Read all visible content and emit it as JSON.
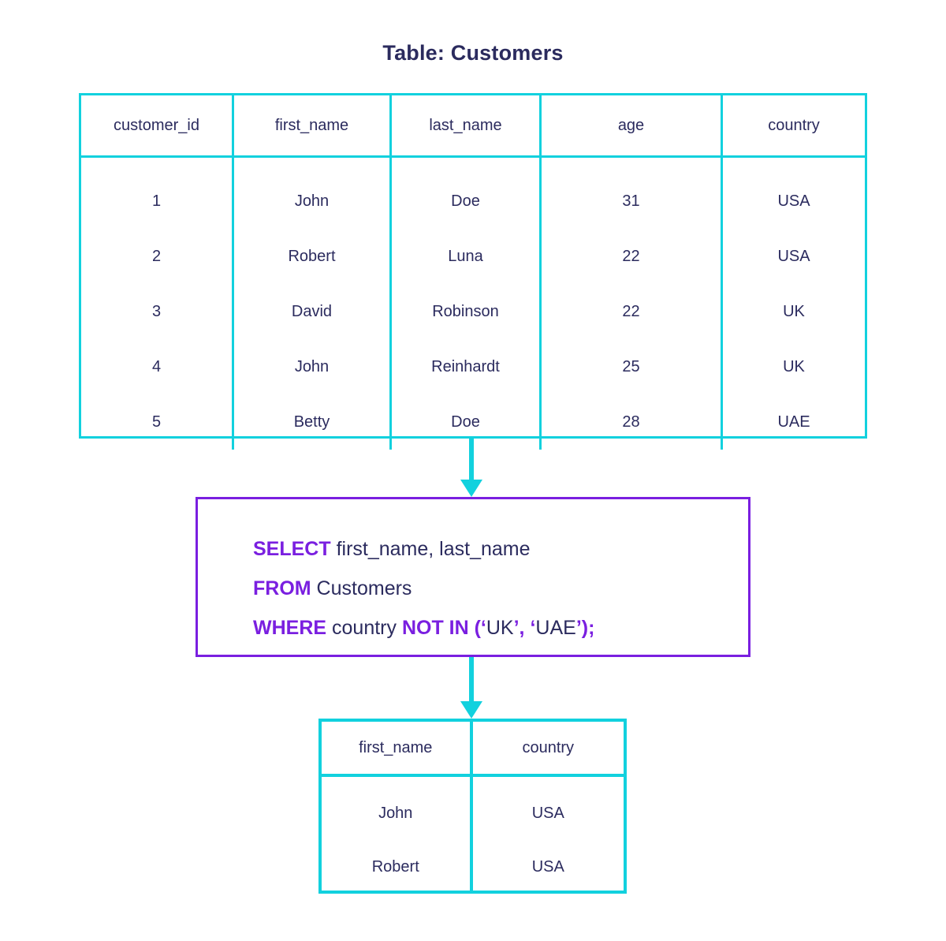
{
  "diagram": {
    "title": "Table: Customers",
    "colors": {
      "table_border": "#12d1de",
      "query_border": "#7a1fe0",
      "keyword": "#7a1fe0",
      "text": "#2b2b5e",
      "arrow": "#12d1de"
    }
  },
  "source_table": {
    "name": "Customers",
    "columns": [
      "customer_id",
      "first_name",
      "last_name",
      "age",
      "country"
    ],
    "rows": [
      [
        "1",
        "John",
        "Doe",
        "31",
        "USA"
      ],
      [
        "2",
        "Robert",
        "Luna",
        "22",
        "USA"
      ],
      [
        "3",
        "David",
        "Robinson",
        "22",
        "UK"
      ],
      [
        "4",
        "John",
        "Reinhardt",
        "25",
        "UK"
      ],
      [
        "5",
        "Betty",
        "Doe",
        "28",
        "UAE"
      ]
    ],
    "column_values": {
      "customer_id": [
        "1",
        "2",
        "3",
        "4",
        "5"
      ],
      "first_name": [
        "John",
        "Robert",
        "David",
        "John",
        "Betty"
      ],
      "last_name": [
        "Doe",
        "Luna",
        "Robinson",
        "Reinhardt",
        "Doe"
      ],
      "age": [
        "31",
        "22",
        "22",
        "25",
        "28"
      ],
      "country": [
        "USA",
        "USA",
        "UK",
        "UK",
        "UAE"
      ]
    }
  },
  "query": {
    "full_text": "SELECT first_name, last_name FROM Customers WHERE country NOT IN ('UK', 'UAE');",
    "line1": {
      "keyword": "SELECT",
      "rest": " first_name, last_name"
    },
    "line2": {
      "keyword": "FROM",
      "rest": " Customers"
    },
    "line3": {
      "keyword": "WHERE",
      "column": " country ",
      "operator": "NOT IN",
      "open": " (‘",
      "value1": "UK",
      "sep": "’, ‘",
      "value2": "UAE",
      "close": "’);"
    }
  },
  "result_table": {
    "columns": [
      "first_name",
      "country"
    ],
    "rows": [
      [
        "John",
        "USA"
      ],
      [
        "Robert",
        "USA"
      ]
    ],
    "column_values": {
      "first_name": [
        "John",
        "Robert"
      ],
      "country": [
        "USA",
        "USA"
      ]
    }
  },
  "arrows": {
    "first_label": "down-arrow",
    "second_label": "down-arrow"
  }
}
